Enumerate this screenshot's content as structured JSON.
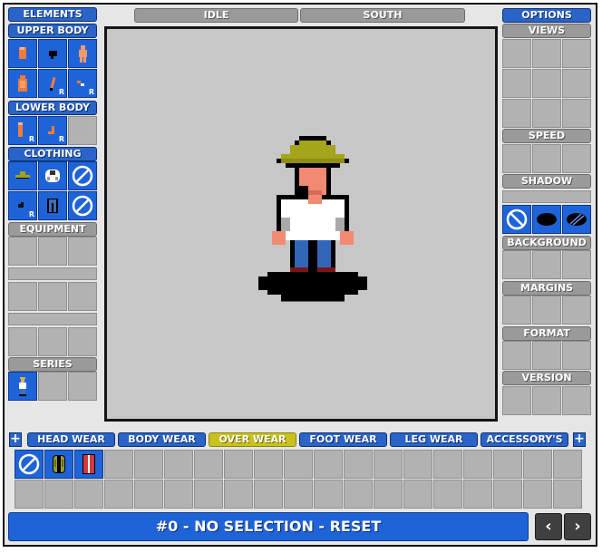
{
  "header": {
    "animation": "IDLE",
    "direction": "SOUTH"
  },
  "left_panel": {
    "elements": "ELEMENTS",
    "upper_body": "UPPER BODY",
    "lower_body": "LOWER BODY",
    "clothing": "CLOTHING",
    "equipment": "EQUIPMENT",
    "series": "SERIES",
    "r_marker": "R"
  },
  "right_panel": {
    "options": "OPTIONS",
    "views": "VIEWS",
    "speed": "SPEED",
    "shadow": "SHADOW",
    "background": "BACKGROUND",
    "margins": "MARGINS",
    "format": "FORMAT",
    "version": "VERSION"
  },
  "bottom": {
    "plus": "+",
    "tabs": [
      "HEAD WEAR",
      "BODY WEAR",
      "OVER WEAR",
      "FOOT WEAR",
      "LEG WEAR",
      "ACCESSORY'S"
    ],
    "active_tab": "OVER WEAR",
    "status": "#0 - NO SELECTION - RESET",
    "prev": "‹",
    "next": "›"
  },
  "colors": {
    "accent": "#1f63d9",
    "active_tab": "#c9c21e",
    "tile": "#b2b2b2",
    "canvas": "#c7c7c7"
  }
}
